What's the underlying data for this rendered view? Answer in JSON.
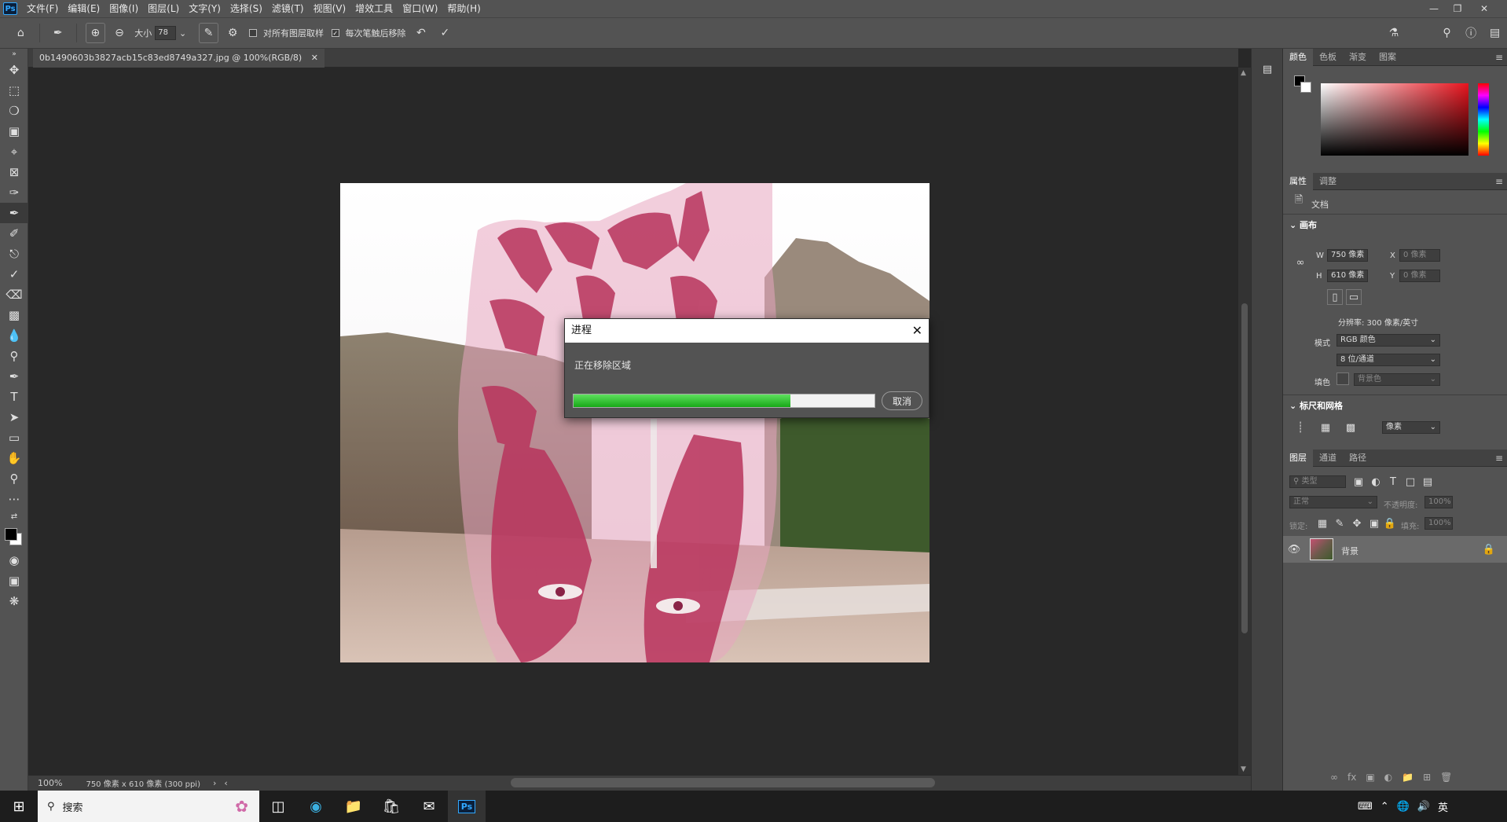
{
  "app": {
    "logo": "Ps"
  },
  "menu": [
    "文件(F)",
    "编辑(E)",
    "图像(I)",
    "图层(L)",
    "文字(Y)",
    "选择(S)",
    "滤镜(T)",
    "视图(V)",
    "增效工具",
    "窗口(W)",
    "帮助(H)"
  ],
  "options": {
    "size_label": "大小",
    "size_value": "78",
    "sample_all_layers": "对所有图层取样",
    "remove_after_stroke": "每次笔触后移除"
  },
  "document": {
    "tab_title": "0b1490603b3827acb15c83ed8749a327.jpg @ 100%(RGB/8)",
    "zoom": "100%",
    "info": "750 像素 x 610 像素 (300 ppi)"
  },
  "dialog": {
    "title": "进程",
    "message": "正在移除区域",
    "progress": 0.72,
    "cancel": "取消"
  },
  "panels": {
    "color_tabs": [
      "颜色",
      "色板",
      "渐变",
      "图案"
    ],
    "props_tabs": [
      "属性",
      "调整"
    ],
    "doc_label": "文档",
    "canvas_section": "画布",
    "w_label": "W",
    "w_value": "750 像素",
    "h_label": "H",
    "h_value": "610 像素",
    "x_label": "X",
    "x_placeholder": "0 像素",
    "y_label": "Y",
    "y_placeholder": "0 像素",
    "resolution": "分辨率: 300 像素/英寸",
    "mode_label": "模式",
    "mode_value": "RGB 颜色",
    "depth_value": "8 位/通道",
    "fill_label": "填色",
    "fill_value": "背景色",
    "rulers_section": "标尺和网格",
    "unit_value": "像素",
    "layers_tabs": [
      "图层",
      "通道",
      "路径"
    ],
    "filter_placeholder": "类型",
    "blend_mode": "正常",
    "opacity_label": "不透明度:",
    "opacity_value": "100%",
    "lock_label": "锁定:",
    "fill2_label": "填充:",
    "fill2_value": "100%",
    "layer_name": "背景"
  },
  "taskbar": {
    "search_placeholder": "搜索",
    "ime": "英"
  },
  "colors": {
    "accent_green": "#18a818",
    "ps_blue": "#31a8ff"
  }
}
